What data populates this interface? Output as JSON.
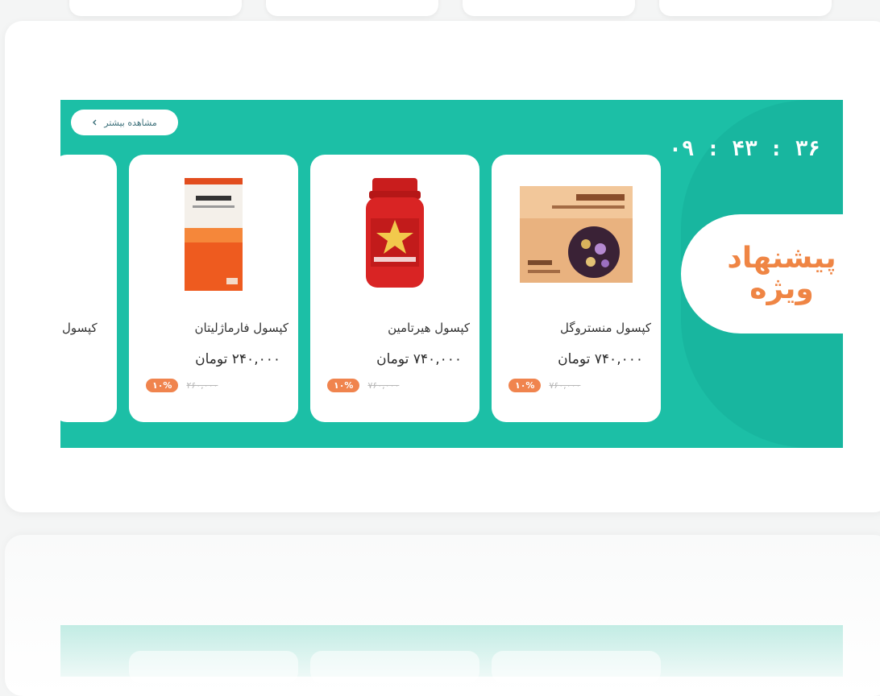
{
  "timer": {
    "text": "۰۹ : ۴۳ : ۳۶"
  },
  "section": {
    "title_line1": "پیشنهاد",
    "title_line2": "ویژه"
  },
  "more_button": {
    "label": "مشاهده بیشتر",
    "icon": "chevron-left-icon"
  },
  "products": [
    {
      "name": "کپسول منستروگل",
      "price": "۷۴۰,۰۰۰ تومان",
      "old_price": "۷۶۰,۰۰۰",
      "discount": "۱۰%",
      "image": "menstrogol-box"
    },
    {
      "name": "کپسول هیرتامین",
      "price": "۷۴۰,۰۰۰ تومان",
      "old_price": "۷۶۰,۰۰۰",
      "discount": "۱۰%",
      "image": "hairtamin-bottle"
    },
    {
      "name": "کپسول فارماژلیتان",
      "price": "۲۴۰,۰۰۰ تومان",
      "old_price": "۲۶۰,۰۰۰",
      "discount": "۱۰%",
      "image": "pharmagelitan-box"
    }
  ],
  "partial_product": {
    "name": "کپسول"
  },
  "colors": {
    "banner": "#1cbfa6",
    "accent": "#ef8544",
    "badge": "#f0844e"
  }
}
